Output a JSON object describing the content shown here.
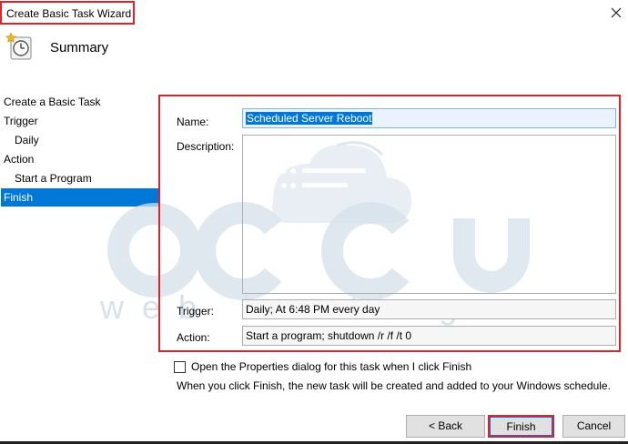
{
  "window": {
    "title": "Create Basic Task Wizard",
    "header_title": "Summary"
  },
  "nav": {
    "items": [
      {
        "label": "Create a Basic Task",
        "level": 0,
        "active": false
      },
      {
        "label": "Trigger",
        "level": 0,
        "active": false
      },
      {
        "label": "Daily",
        "level": 1,
        "active": false
      },
      {
        "label": "Action",
        "level": 0,
        "active": false
      },
      {
        "label": "Start a Program",
        "level": 1,
        "active": false
      },
      {
        "label": "Finish",
        "level": 0,
        "active": true
      }
    ]
  },
  "form": {
    "name_label": "Name:",
    "name_value": "Scheduled Server Reboot",
    "description_label": "Description:",
    "description_value": "",
    "trigger_label": "Trigger:",
    "trigger_value": "Daily; At 6:48 PM every day",
    "action_label": "Action:",
    "action_value": "Start a program; shutdown /r /f /t 0"
  },
  "options": {
    "open_properties_label": "Open the Properties dialog for this task when I click Finish",
    "open_properties_checked": false,
    "info_text": "When you click Finish, the new task will be created and added to your Windows schedule."
  },
  "buttons": {
    "back": "< Back",
    "finish": "Finish",
    "cancel": "Cancel"
  },
  "watermark": {
    "brand": "accu",
    "tagline": "web hosting"
  },
  "colors": {
    "selection": "#0078d7",
    "highlight_border": "#e0202a"
  },
  "icons": {
    "close": "close-icon",
    "task": "scheduled-task-clock-icon"
  }
}
